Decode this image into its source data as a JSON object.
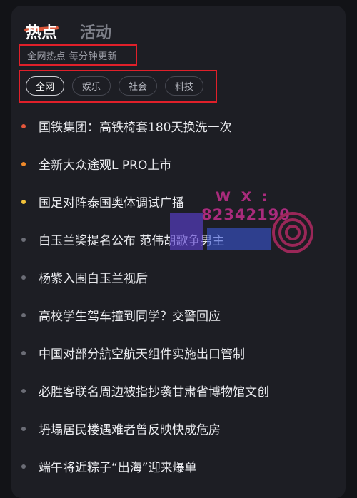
{
  "tabs": [
    {
      "label": "热点",
      "active": true
    },
    {
      "label": "活动",
      "active": false
    }
  ],
  "subtitle": "全网热点 每分钟更新",
  "filters": [
    {
      "label": "全网",
      "active": true
    },
    {
      "label": "娱乐",
      "active": false
    },
    {
      "label": "社会",
      "active": false
    },
    {
      "label": "科技",
      "active": false
    }
  ],
  "items": [
    {
      "text": "国铁集团：高铁椅套180天换洗一次",
      "dot_color": "#e5563b"
    },
    {
      "text": "全新大众途观L PRO上市",
      "dot_color": "#f08a2a"
    },
    {
      "text": "国足对阵泰国奥体调试广播",
      "dot_color": "#f3c33a"
    },
    {
      "text": "白玉兰奖提名公布 范伟胡歌争男主",
      "dot_color": "#6b6d76"
    },
    {
      "text": "杨紫入围白玉兰视后",
      "dot_color": "#6b6d76"
    },
    {
      "text": "高校学生驾车撞到同学？交警回应",
      "dot_color": "#6b6d76"
    },
    {
      "text": "中国对部分航空航天组件实施出口管制",
      "dot_color": "#6b6d76"
    },
    {
      "text": "必胜客联名周边被指抄袭甘肃省博物馆文创",
      "dot_color": "#6b6d76"
    },
    {
      "text": "坍塌居民楼遇难者曾反映快成危房",
      "dot_color": "#6b6d76"
    },
    {
      "text": "端午将近粽子“出海”迎来爆单",
      "dot_color": "#6b6d76"
    }
  ],
  "watermark": {
    "line1": "W X :",
    "line2": "82342190"
  },
  "colors": {
    "background": "#1d1e24",
    "highlight_box": "#e0202a",
    "tab_accent": "#f05c3c"
  }
}
